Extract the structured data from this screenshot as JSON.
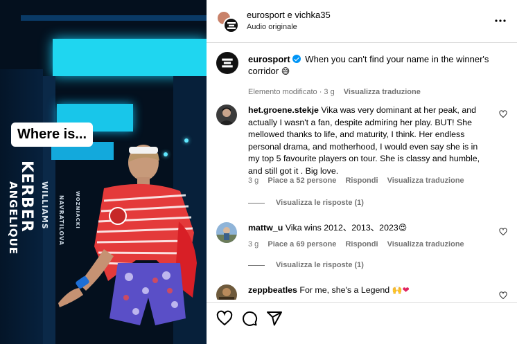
{
  "media": {
    "overlay_text": "Where is...",
    "name_kerber": "KERBER",
    "name_angelique": "ANGELIQUE",
    "name_williams": "WILLIAMS",
    "name_small1": "NAVRATILOVA",
    "name_small2": "WOZNIACKI"
  },
  "header": {
    "names": "eurosport e vichka35",
    "audio": "Audio originale"
  },
  "caption": {
    "username": "eurosport",
    "text": "When you can't find your name in the winner's corridor",
    "emoji": "😅",
    "edited": "Elemento modificato · 3 g",
    "translate": "Visualizza traduzione"
  },
  "comments": [
    {
      "username": "het.groene.stekje",
      "text": "Vika was very dominant at her peak, and actually I wasn't a fan, despite admiring her play. BUT! She mellowed thanks to life, and maturity, I think. Her endless personal drama, and motherhood, I would even say she is in my top 5 favourite players on tour. She is classy and humble, and still got it . Big love.",
      "time": "3 g",
      "likes": "Piace a 52 persone",
      "reply": "Rispondi",
      "translate": "Visualizza traduzione",
      "view_replies": "Visualizza le risposte (1)"
    },
    {
      "username": "mattw_u",
      "text": "Vika wins 2012、2013、2023",
      "emoji": "😍",
      "time": "3 g",
      "likes": "Piace a 69 persone",
      "reply": "Rispondi",
      "translate": "Visualizza traduzione",
      "view_replies": "Visualizza le risposte (1)"
    },
    {
      "username": "zeppbeatles",
      "text": "For me, she's a Legend",
      "emoji": "🙌❤"
    }
  ],
  "icons": {
    "like": "heart-icon",
    "comment": "comment-icon",
    "share": "share-icon",
    "more": "more-icon"
  },
  "colors": {
    "accent": "#0095f6",
    "secondary_text": "#737373",
    "divider": "#dbdbdb"
  }
}
